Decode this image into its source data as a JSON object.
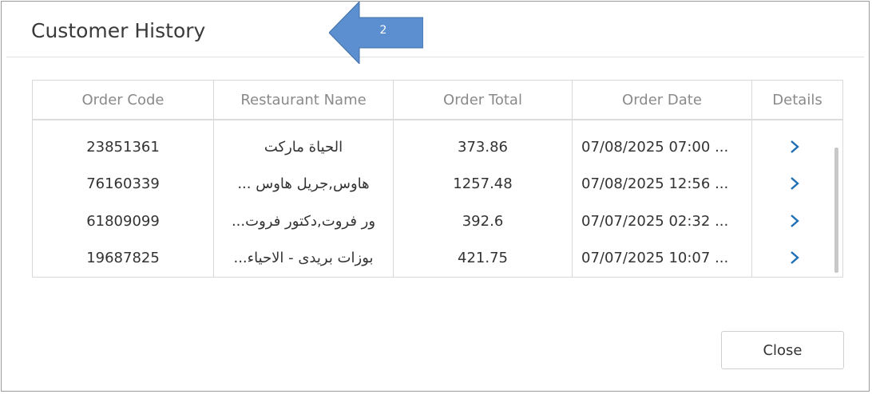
{
  "dialog": {
    "title": "Customer History"
  },
  "annotation": {
    "label": "2",
    "color": "#5b8fcf"
  },
  "table": {
    "columns": [
      "Order Code",
      "Restaurant Name",
      "Order Total",
      "Order Date",
      "Details"
    ],
    "rows": [
      {
        "code": "23851361",
        "restaurant": "الحياة ماركت",
        "total": "373.86",
        "date": "07/08/2025 07:00 ..."
      },
      {
        "code": "76160339",
        "restaurant": "هاوس,جريل هاوس ...",
        "total": "1257.48",
        "date": "07/08/2025 12:56 ..."
      },
      {
        "code": "61809099",
        "restaurant": "ور فروت,دكتور فروت...",
        "total": "392.6",
        "date": "07/07/2025 02:32 ..."
      },
      {
        "code": "19687825",
        "restaurant": "بوزات بريدى - الاحياء...",
        "total": "421.75",
        "date": "07/07/2025 10:07 ..."
      }
    ],
    "details_icon": "chevron-right-icon",
    "accent_color": "#1f6fb5"
  },
  "footer": {
    "close_label": "Close"
  }
}
